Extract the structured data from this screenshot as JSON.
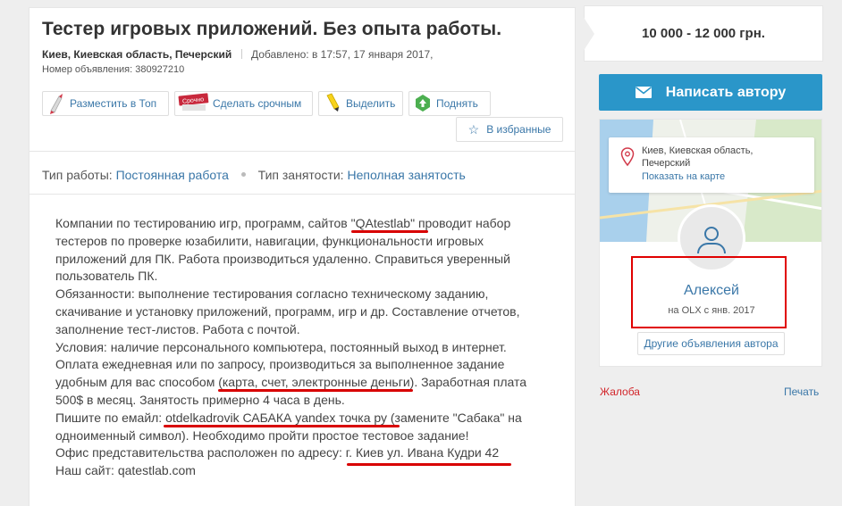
{
  "ad": {
    "title": "Тестер игровых приложений. Без опыта работы.",
    "location": "Киев, Киевская область, Печерский",
    "added": "Добавлено: в 17:57, 17 января 2017,",
    "number": "Номер объявления: 380927210"
  },
  "actions": {
    "top": "Разместить в Топ",
    "urgent": "Сделать срочным",
    "urgent_badge": "Срочно",
    "highlight": "Выделить",
    "up": "Поднять",
    "favorite": "В избранные"
  },
  "details": {
    "job_type_label": "Тип работы:",
    "job_type_value": "Постоянная работа",
    "employment_label": "Тип занятости:",
    "employment_value": "Неполная занятость"
  },
  "description": [
    "Компании по тестированию игр, программ, сайтов \"QAtestlab\" проводит набор",
    "тестеров по проверке юзабилити, навигации, функциональности игровых",
    "приложений для ПК. Работа производиться удаленно. Справиться уверенный",
    "пользователь ПК.",
    "Обязанности: выполнение тестирования согласно техническому заданию,",
    "скачивание и установку приложений, программ, игр и др. Составление отчетов,",
    "заполнение тест-листов. Работа с почтой.",
    "Условия: наличие персонального компьютера, постоянный выход в интернет.",
    "Оплата ежедневная или по запросу, производиться за выполненное задание",
    "удобным для вас способом (карта, счет, электронные деньги). Заработная плата",
    "500$ в месяц. Занятость примерно 4 часа в день.",
    "Пишите по емайл: otdelkadrovik САБАКА yandex точка ру (замените \"Сабака\" на",
    "одноименный символ). Необходимо пройти простое тестовое задание!",
    "Офис представительства расположен по адресу: г. Киев ул. Ивана Кудри 42",
    "Наш сайт: qatestlab.com"
  ],
  "sidebar": {
    "price": "10 000 - 12 000 грн.",
    "write_button": "Написать автору",
    "map_address_line1": "Киев, Киевская область,",
    "map_address_line2": "Печерский",
    "map_link": "Показать на карте",
    "author_name": "Алексей",
    "author_since": "на OLX с янв. 2017",
    "other_ads": "Другие объявления автора",
    "complain": "Жалоба",
    "print": "Печать"
  },
  "colors": {
    "link": "#3a77a8",
    "button_blue": "#2a96c9",
    "annotation_red": "#e00000",
    "complain_red": "#d2262b"
  }
}
